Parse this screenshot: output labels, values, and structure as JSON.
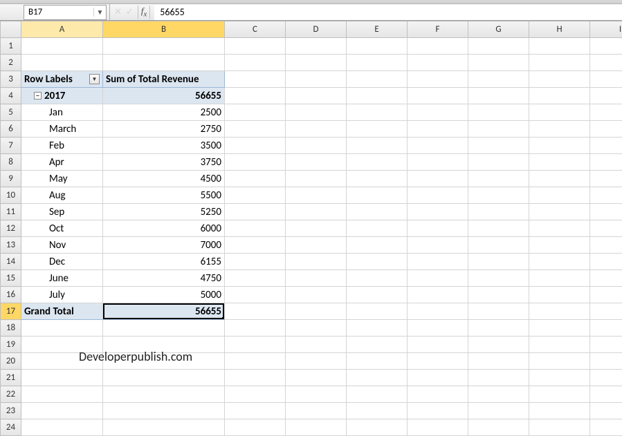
{
  "nameBox": "B17",
  "formulaValue": "56655",
  "columns": [
    "A",
    "B",
    "C",
    "D",
    "E",
    "F",
    "G",
    "H",
    "I"
  ],
  "rowCount": 24,
  "pivot": {
    "headerA": "Row Labels",
    "headerB": "Sum of Total Revenue",
    "year": "2017",
    "yearTotal": "56655",
    "rows": [
      {
        "label": "Jan",
        "value": "2500"
      },
      {
        "label": "March",
        "value": "2750"
      },
      {
        "label": "Feb",
        "value": "3500"
      },
      {
        "label": "Apr",
        "value": "3750"
      },
      {
        "label": "May",
        "value": "4500"
      },
      {
        "label": "Aug",
        "value": "5500"
      },
      {
        "label": "Sep",
        "value": "5250"
      },
      {
        "label": "Oct",
        "value": "6000"
      },
      {
        "label": "Nov",
        "value": "7000"
      },
      {
        "label": "Dec",
        "value": "6155"
      },
      {
        "label": "June",
        "value": "4750"
      },
      {
        "label": "July",
        "value": "5000"
      }
    ],
    "grandLabel": "Grand Total",
    "grandValue": "56655"
  },
  "watermark": "Developerpublish.com",
  "colWidths": {
    "A": 118,
    "B": 176,
    "others": 88
  }
}
